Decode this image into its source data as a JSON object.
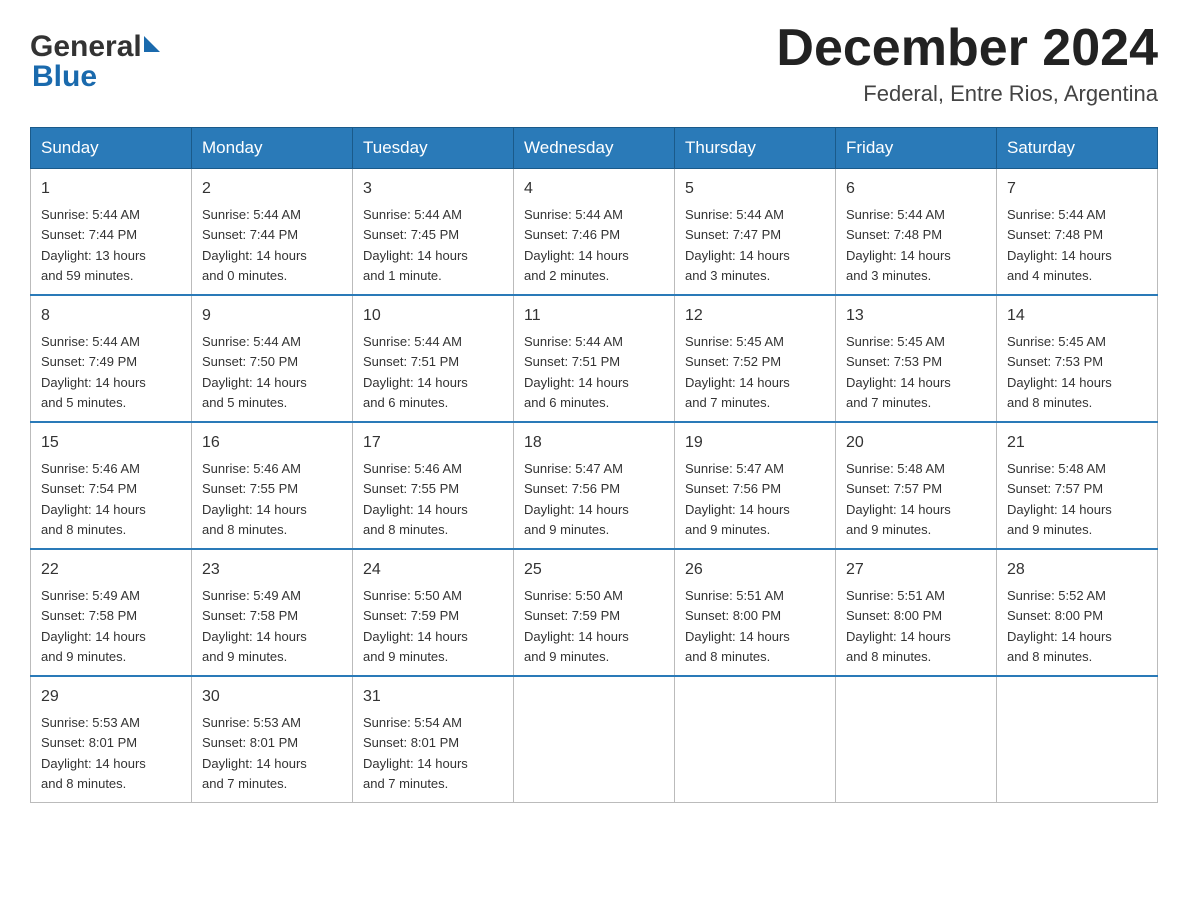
{
  "header": {
    "logo_general": "General",
    "logo_blue": "Blue",
    "month_title": "December 2024",
    "location": "Federal, Entre Rios, Argentina"
  },
  "days_of_week": [
    "Sunday",
    "Monday",
    "Tuesday",
    "Wednesday",
    "Thursday",
    "Friday",
    "Saturday"
  ],
  "weeks": [
    [
      {
        "day": "1",
        "sunrise": "5:44 AM",
        "sunset": "7:44 PM",
        "daylight": "13 hours and 59 minutes."
      },
      {
        "day": "2",
        "sunrise": "5:44 AM",
        "sunset": "7:44 PM",
        "daylight": "14 hours and 0 minutes."
      },
      {
        "day": "3",
        "sunrise": "5:44 AM",
        "sunset": "7:45 PM",
        "daylight": "14 hours and 1 minute."
      },
      {
        "day": "4",
        "sunrise": "5:44 AM",
        "sunset": "7:46 PM",
        "daylight": "14 hours and 2 minutes."
      },
      {
        "day": "5",
        "sunrise": "5:44 AM",
        "sunset": "7:47 PM",
        "daylight": "14 hours and 3 minutes."
      },
      {
        "day": "6",
        "sunrise": "5:44 AM",
        "sunset": "7:48 PM",
        "daylight": "14 hours and 3 minutes."
      },
      {
        "day": "7",
        "sunrise": "5:44 AM",
        "sunset": "7:48 PM",
        "daylight": "14 hours and 4 minutes."
      }
    ],
    [
      {
        "day": "8",
        "sunrise": "5:44 AM",
        "sunset": "7:49 PM",
        "daylight": "14 hours and 5 minutes."
      },
      {
        "day": "9",
        "sunrise": "5:44 AM",
        "sunset": "7:50 PM",
        "daylight": "14 hours and 5 minutes."
      },
      {
        "day": "10",
        "sunrise": "5:44 AM",
        "sunset": "7:51 PM",
        "daylight": "14 hours and 6 minutes."
      },
      {
        "day": "11",
        "sunrise": "5:44 AM",
        "sunset": "7:51 PM",
        "daylight": "14 hours and 6 minutes."
      },
      {
        "day": "12",
        "sunrise": "5:45 AM",
        "sunset": "7:52 PM",
        "daylight": "14 hours and 7 minutes."
      },
      {
        "day": "13",
        "sunrise": "5:45 AM",
        "sunset": "7:53 PM",
        "daylight": "14 hours and 7 minutes."
      },
      {
        "day": "14",
        "sunrise": "5:45 AM",
        "sunset": "7:53 PM",
        "daylight": "14 hours and 8 minutes."
      }
    ],
    [
      {
        "day": "15",
        "sunrise": "5:46 AM",
        "sunset": "7:54 PM",
        "daylight": "14 hours and 8 minutes."
      },
      {
        "day": "16",
        "sunrise": "5:46 AM",
        "sunset": "7:55 PM",
        "daylight": "14 hours and 8 minutes."
      },
      {
        "day": "17",
        "sunrise": "5:46 AM",
        "sunset": "7:55 PM",
        "daylight": "14 hours and 8 minutes."
      },
      {
        "day": "18",
        "sunrise": "5:47 AM",
        "sunset": "7:56 PM",
        "daylight": "14 hours and 9 minutes."
      },
      {
        "day": "19",
        "sunrise": "5:47 AM",
        "sunset": "7:56 PM",
        "daylight": "14 hours and 9 minutes."
      },
      {
        "day": "20",
        "sunrise": "5:48 AM",
        "sunset": "7:57 PM",
        "daylight": "14 hours and 9 minutes."
      },
      {
        "day": "21",
        "sunrise": "5:48 AM",
        "sunset": "7:57 PM",
        "daylight": "14 hours and 9 minutes."
      }
    ],
    [
      {
        "day": "22",
        "sunrise": "5:49 AM",
        "sunset": "7:58 PM",
        "daylight": "14 hours and 9 minutes."
      },
      {
        "day": "23",
        "sunrise": "5:49 AM",
        "sunset": "7:58 PM",
        "daylight": "14 hours and 9 minutes."
      },
      {
        "day": "24",
        "sunrise": "5:50 AM",
        "sunset": "7:59 PM",
        "daylight": "14 hours and 9 minutes."
      },
      {
        "day": "25",
        "sunrise": "5:50 AM",
        "sunset": "7:59 PM",
        "daylight": "14 hours and 9 minutes."
      },
      {
        "day": "26",
        "sunrise": "5:51 AM",
        "sunset": "8:00 PM",
        "daylight": "14 hours and 8 minutes."
      },
      {
        "day": "27",
        "sunrise": "5:51 AM",
        "sunset": "8:00 PM",
        "daylight": "14 hours and 8 minutes."
      },
      {
        "day": "28",
        "sunrise": "5:52 AM",
        "sunset": "8:00 PM",
        "daylight": "14 hours and 8 minutes."
      }
    ],
    [
      {
        "day": "29",
        "sunrise": "5:53 AM",
        "sunset": "8:01 PM",
        "daylight": "14 hours and 8 minutes."
      },
      {
        "day": "30",
        "sunrise": "5:53 AM",
        "sunset": "8:01 PM",
        "daylight": "14 hours and 7 minutes."
      },
      {
        "day": "31",
        "sunrise": "5:54 AM",
        "sunset": "8:01 PM",
        "daylight": "14 hours and 7 minutes."
      },
      null,
      null,
      null,
      null
    ]
  ],
  "labels": {
    "sunrise": "Sunrise:",
    "sunset": "Sunset:",
    "daylight": "Daylight:"
  }
}
